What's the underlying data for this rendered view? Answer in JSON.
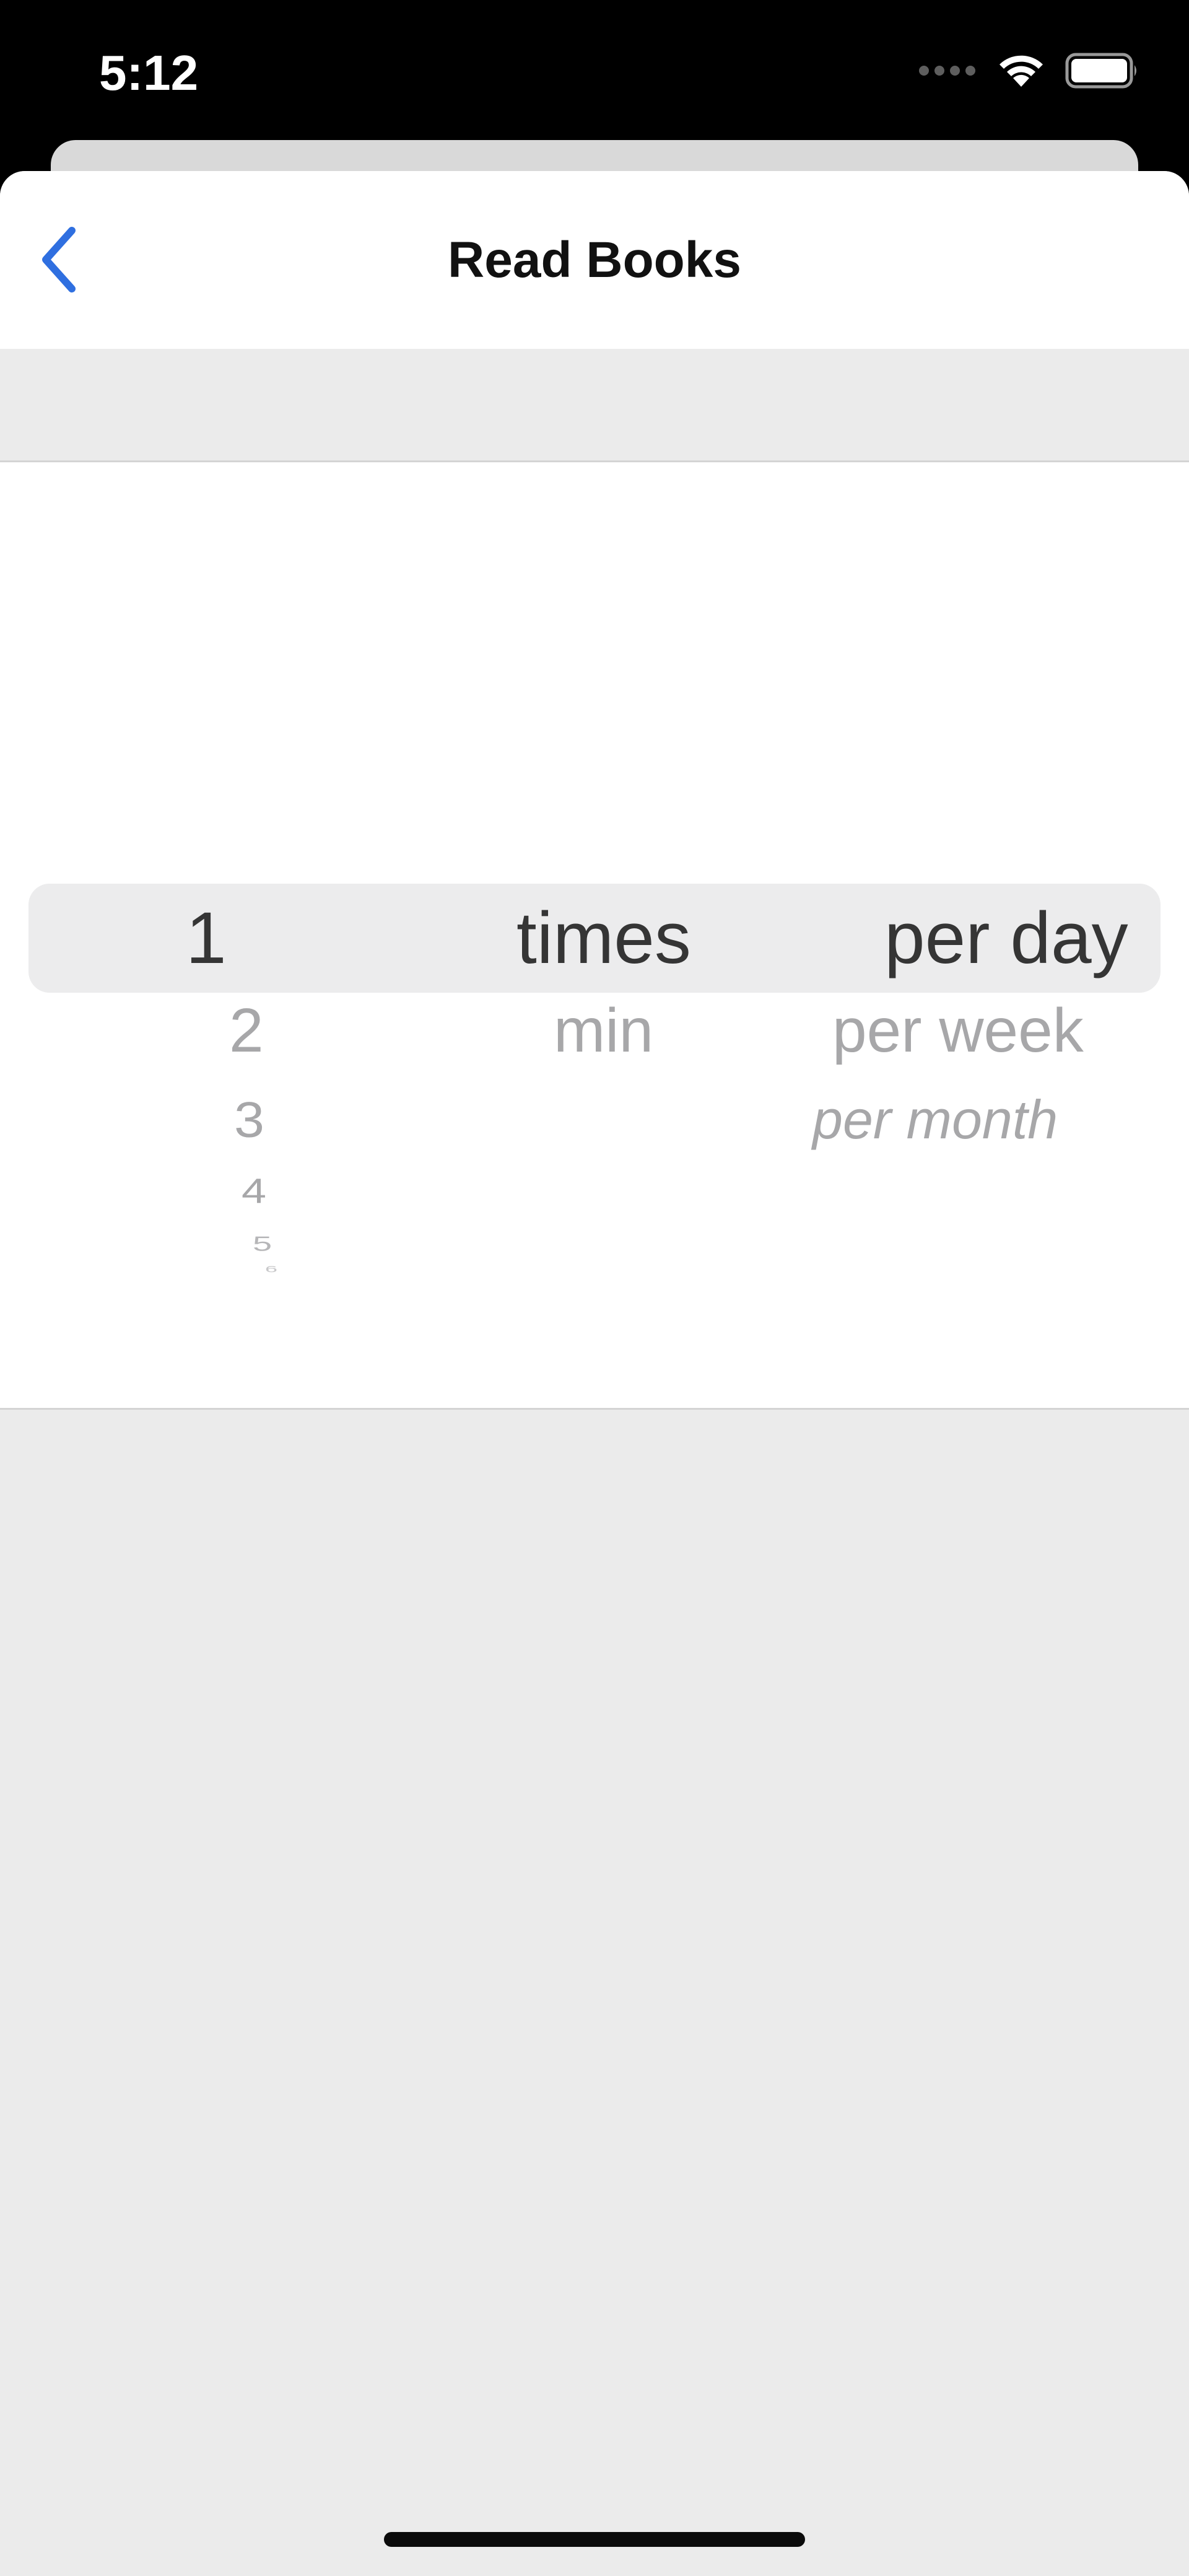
{
  "status_bar": {
    "time": "5:12",
    "signal_icon": "cellular-dots-icon",
    "wifi_icon": "wifi-icon",
    "battery_icon": "battery-full-icon"
  },
  "nav": {
    "back_icon": "chevron-left-icon",
    "title": "Read Books"
  },
  "picker": {
    "columns": [
      {
        "name": "count",
        "selected": "1",
        "options": [
          "1",
          "2",
          "3",
          "4",
          "5",
          "6"
        ]
      },
      {
        "name": "unit",
        "selected": "times",
        "options": [
          "times",
          "min"
        ]
      },
      {
        "name": "period",
        "selected": "per day",
        "options": [
          "per day",
          "per week",
          "per month"
        ]
      }
    ]
  },
  "colors": {
    "accent": "#2f6fe0",
    "sheet_background": "#ebebeb",
    "selected_text": "#353535",
    "unselected_text": "#a7a7a9"
  }
}
